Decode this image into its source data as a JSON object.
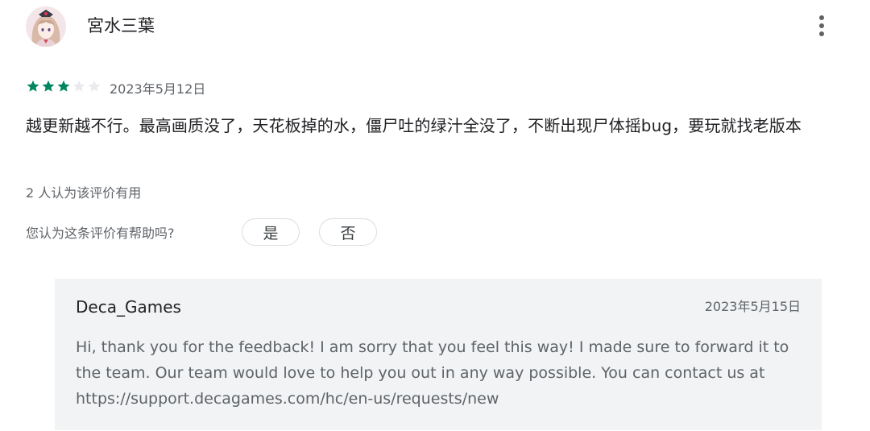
{
  "review": {
    "author": "宮水三葉",
    "rating": 3,
    "max_rating": 5,
    "date": "2023年5月12日",
    "text": "越更新越不行。最高画质没了，天花板掉的水，僵尸吐的绿汁全没了，不断出现尸体摇bug，要玩就找老版本",
    "helpful_count_text": "2 人认为该评价有用",
    "helpful_question": "您认为这条评价有帮助吗?",
    "vote_yes_label": "是",
    "vote_no_label": "否"
  },
  "developer_reply": {
    "name": "Deca_Games",
    "date": "2023年5月15日",
    "text": "Hi, thank you for the feedback! I am sorry that you feel this way! I made sure to forward it to the team. Our team would love to help you out in any way possible. You can contact us at https://support.decagames.com/hc/en-us/requests/new"
  },
  "colors": {
    "star_filled": "#01875f",
    "star_empty": "#e8eaed",
    "reply_background": "#f1f3f4"
  },
  "icons": {
    "avatar": "user-avatar",
    "more": "more-vert-icon",
    "star": "star-icon"
  }
}
